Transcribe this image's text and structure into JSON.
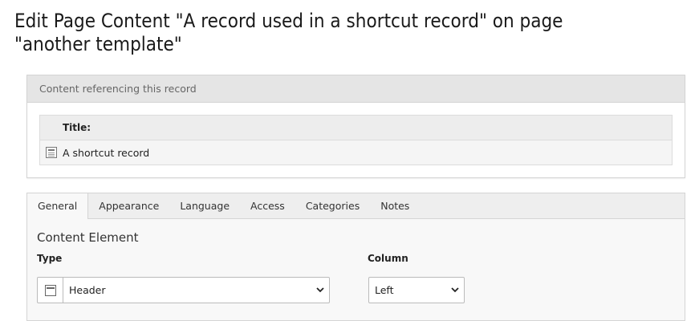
{
  "page": {
    "title": "Edit Page Content \"A record used in a shortcut record\" on page \"another template\""
  },
  "references": {
    "header": "Content referencing this record",
    "column_title": "Title:",
    "rows": [
      {
        "icon": "content-element-icon",
        "title": "A shortcut record"
      }
    ]
  },
  "tabs": [
    {
      "label": "General",
      "active": true
    },
    {
      "label": "Appearance",
      "active": false
    },
    {
      "label": "Language",
      "active": false
    },
    {
      "label": "Access",
      "active": false
    },
    {
      "label": "Categories",
      "active": false
    },
    {
      "label": "Notes",
      "active": false
    }
  ],
  "form": {
    "section_title": "Content Element",
    "type_label": "Type",
    "type_value": "Header",
    "type_icon": "header-icon",
    "column_label": "Column",
    "column_value": "Left"
  }
}
